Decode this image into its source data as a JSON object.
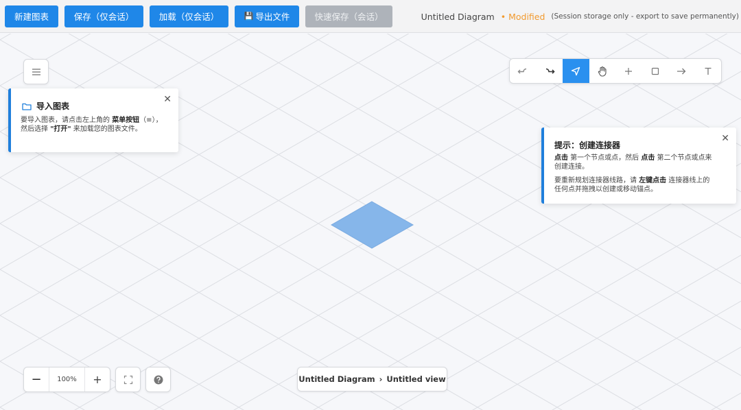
{
  "toolbar_top": {
    "new_label": "新建图表",
    "save_label": "保存（仅会话）",
    "load_label": "加载（仅会话）",
    "export_label": "导出文件",
    "quicksave_label": "快速保存（会话）"
  },
  "status": {
    "title": "Untitled Diagram",
    "modified": "• Modified",
    "note": "(Session storage only - export to save permanently)"
  },
  "import_card": {
    "title": "导入图表",
    "text_1": "要导入图表，请点击左上角的 ",
    "menu_button": "菜单按钮",
    "text_2": "（≡），然后选择 ",
    "open": "\"打开\"",
    "text_3": " 来加载您的图表文件。",
    "close": "✕"
  },
  "tip_card": {
    "title": "提示：创建连接器",
    "p1_a": "点击",
    "p1_b": " 第一个节点或点，然后 ",
    "p1_c": "点击",
    "p1_d": " 第二个节点或点来创建连接。",
    "p2_a": "要重新规划连接器线路，请 ",
    "p2_b": "左键点击",
    "p2_c": " 连接器线上的任何点并拖拽以创建或移动锚点。",
    "close": "✕"
  },
  "zoom": {
    "minus": "−",
    "value": "100%",
    "plus": "+"
  },
  "breadcrumb": {
    "diagram": "Untitled Diagram",
    "sep": "›",
    "view": "Untitled view"
  },
  "colors": {
    "primary_button": "#1f87e8",
    "disabled_button": "#aeb3ba",
    "modified": "#f29a2e",
    "active_tool": "#2a90ef",
    "diamond": "#86b6ea",
    "card_accent": "#1f7fdc"
  },
  "icons": {
    "menu": "hamburger-icon",
    "undo": "undo-icon",
    "redo": "redo-icon",
    "select": "cursor-arrow-icon",
    "pan": "hand-icon",
    "add": "plus-icon",
    "rectangle": "square-icon",
    "connector": "arrow-right-icon",
    "text": "text-icon",
    "fit": "fit-screen-icon",
    "help": "help-icon",
    "folder": "folder-icon",
    "save_disk": "floppy-disk-icon"
  },
  "active_tool": "select"
}
